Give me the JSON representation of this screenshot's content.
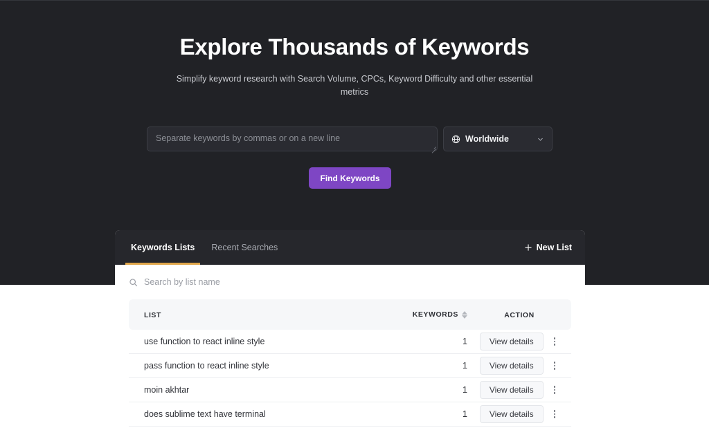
{
  "hero": {
    "title": "Explore Thousands of Keywords",
    "subtitle": "Simplify keyword research with Search Volume, CPCs, Keyword Difficulty and other essential metrics",
    "background_color": "#212226"
  },
  "search": {
    "keywords_placeholder": "Separate keywords by commas or on a new line",
    "keywords_value": "",
    "region_label": "Worldwide",
    "region_icon": "globe-icon",
    "chevron_icon": "chevron-down-icon",
    "resize_handle_icon": "resize-grip-icon",
    "find_button_label": "Find Keywords",
    "find_button_color": "#7e46c4"
  },
  "card": {
    "tabs": [
      {
        "label": "Keywords Lists",
        "active": true
      },
      {
        "label": "Recent Searches",
        "active": false
      }
    ],
    "active_tab_underline_color": "#e0a64a",
    "new_list": {
      "label": "New List",
      "icon": "plus-icon"
    },
    "list_search": {
      "placeholder": "Search by list name",
      "value": "",
      "icon": "search-icon"
    },
    "table": {
      "columns": [
        {
          "key": "list",
          "label": "LIST",
          "sortable": false
        },
        {
          "key": "keywords",
          "label": "KEYWORDS",
          "sortable": true,
          "sort_icon": "sort-updown-icon"
        },
        {
          "key": "action",
          "label": "ACTION",
          "sortable": false
        }
      ],
      "rows": [
        {
          "list": "use function to react inline style",
          "keywords": "1",
          "action_label": "View details",
          "menu_icon": "kebab-menu-icon"
        },
        {
          "list": "pass function to react inline style",
          "keywords": "1",
          "action_label": "View details",
          "menu_icon": "kebab-menu-icon"
        },
        {
          "list": "moin akhtar",
          "keywords": "1",
          "action_label": "View details",
          "menu_icon": "kebab-menu-icon"
        },
        {
          "list": "does sublime text have terminal",
          "keywords": "1",
          "action_label": "View details",
          "menu_icon": "kebab-menu-icon"
        }
      ]
    }
  }
}
